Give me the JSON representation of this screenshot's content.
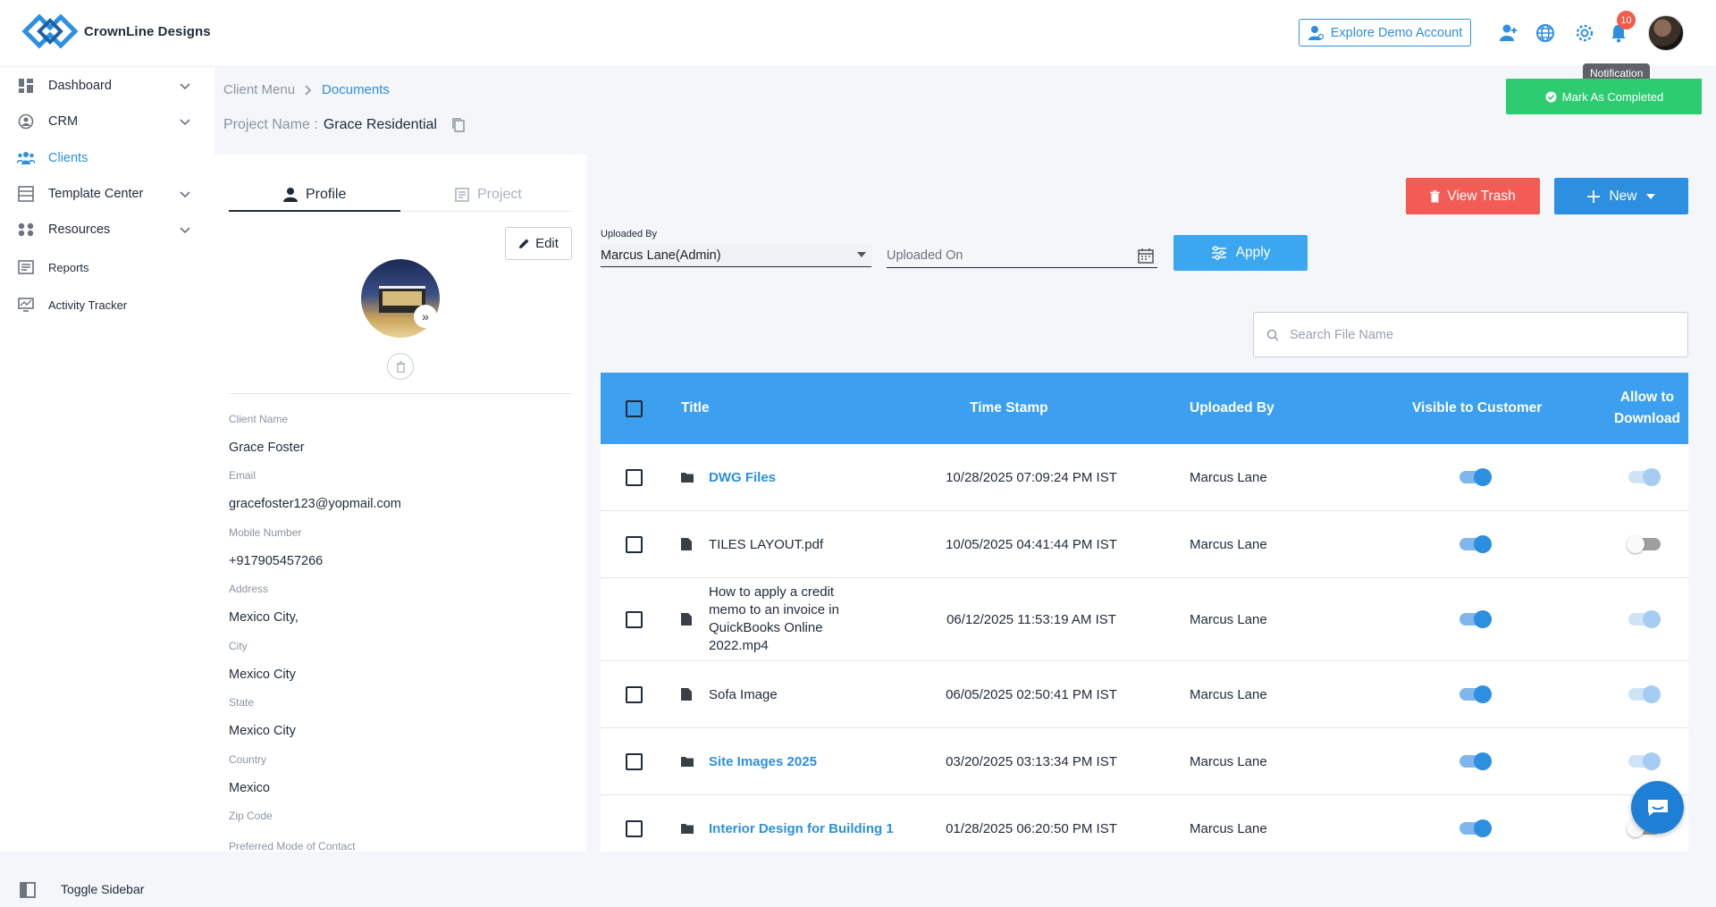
{
  "header": {
    "brand": "CrownLine Designs",
    "demo_label": "Explore Demo Account",
    "notification_count": "10",
    "tooltip": "Notification"
  },
  "sidebar": {
    "items": [
      {
        "label": "Dashboard",
        "icon": "dashboard-icon",
        "expandable": true
      },
      {
        "label": "CRM",
        "icon": "crm-icon",
        "expandable": true
      },
      {
        "label": "Clients",
        "icon": "clients-icon",
        "active": true
      },
      {
        "label": "Template Center",
        "icon": "template-icon",
        "expandable": true
      },
      {
        "label": "Resources",
        "icon": "resources-icon",
        "expandable": true
      },
      {
        "label": "Reports",
        "icon": "reports-icon"
      },
      {
        "label": "Activity Tracker",
        "icon": "activity-icon"
      }
    ],
    "toggle_label": "Toggle Sidebar"
  },
  "breadcrumb": {
    "parent": "Client Menu",
    "current": "Documents"
  },
  "project": {
    "label": "Project Name :",
    "name": "Grace Residential"
  },
  "mark_completed_label": "Mark As Completed",
  "profile": {
    "tab_profile": "Profile",
    "tab_project": "Project",
    "edit_label": "Edit",
    "fields": [
      {
        "label": "Client Name",
        "value": "Grace Foster"
      },
      {
        "label": "Email",
        "value": "gracefoster123@yopmail.com"
      },
      {
        "label": "Mobile Number",
        "value": "+917905457266"
      },
      {
        "label": "Address",
        "value": "Mexico City,"
      },
      {
        "label": "City",
        "value": "Mexico City"
      },
      {
        "label": "State",
        "value": "Mexico City"
      },
      {
        "label": "Country",
        "value": "Mexico"
      },
      {
        "label": "Zip Code",
        "value": ""
      },
      {
        "label": "Preferred Mode of Contact",
        "value": ""
      }
    ]
  },
  "toolbar": {
    "view_trash": "View Trash",
    "new": "New",
    "apply": "Apply"
  },
  "filters": {
    "uploaded_by_label": "Uploaded By",
    "uploaded_by_value": "Marcus Lane(Admin)",
    "uploaded_on_placeholder": "Uploaded On",
    "search_placeholder": "Search File Name"
  },
  "table": {
    "columns": [
      "Title",
      "Time Stamp",
      "Uploaded By",
      "Visible to Customer",
      "Allow to Download"
    ],
    "rows": [
      {
        "type": "folder",
        "title": "DWG Files",
        "timestamp": "10/28/2025 07:09:24 PM IST",
        "uploaded_by": "Marcus Lane",
        "visible": true,
        "download": true
      },
      {
        "type": "file",
        "title": "TILES LAYOUT.pdf",
        "timestamp": "10/05/2025 04:41:44 PM IST",
        "uploaded_by": "Marcus Lane",
        "visible": true,
        "download": false
      },
      {
        "type": "file",
        "title": "How to apply a credit memo to an invoice in QuickBooks Online 2022.mp4",
        "timestamp": "06/12/2025 11:53:19 AM IST",
        "uploaded_by": "Marcus Lane",
        "visible": true,
        "download": true
      },
      {
        "type": "file",
        "title": "Sofa Image",
        "timestamp": "06/05/2025 02:50:41 PM IST",
        "uploaded_by": "Marcus Lane",
        "visible": true,
        "download": true
      },
      {
        "type": "folder",
        "title": "Site Images 2025",
        "timestamp": "03/20/2025 03:13:34 PM IST",
        "uploaded_by": "Marcus Lane",
        "visible": true,
        "download": true
      },
      {
        "type": "folder",
        "title": "Interior Design for Building 1",
        "timestamp": "01/28/2025 06:20:50 PM IST",
        "uploaded_by": "Marcus Lane",
        "visible": true,
        "download": false
      }
    ]
  },
  "colors": {
    "primary": "#2d8fe0",
    "success": "#2ecc71",
    "danger": "#f25c54",
    "table_header": "#3c9ff0"
  }
}
